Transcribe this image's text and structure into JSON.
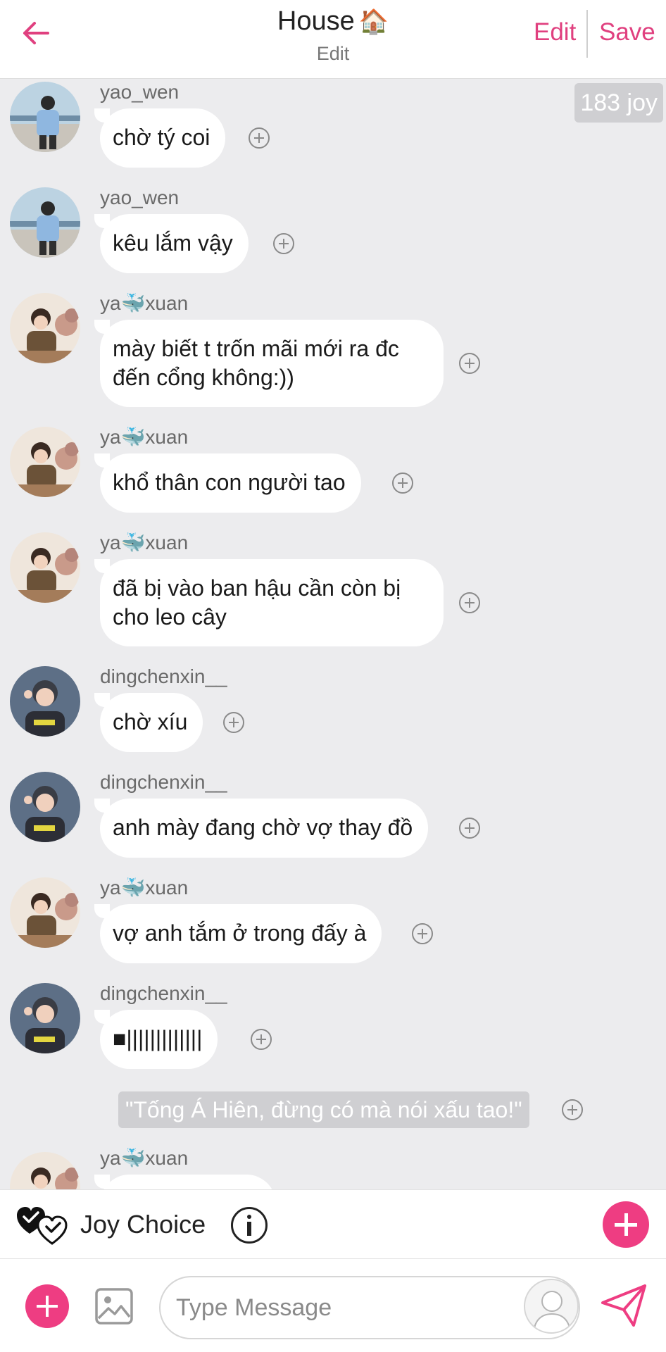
{
  "header": {
    "title": "House",
    "title_emoji": "🏠",
    "subtitle": "Edit",
    "edit_label": "Edit",
    "save_label": "Save",
    "back_icon": "arrow-left-icon",
    "accent_color": "#e0407f"
  },
  "chat": {
    "joy_badge": "183 joy",
    "messages": [
      {
        "user": "yao_wen",
        "lines": [
          "chờ tý coi"
        ],
        "avatar": "yao-wen"
      },
      {
        "user": "yao_wen",
        "lines": [
          "kêu lắm vậy"
        ],
        "avatar": "yao-wen"
      },
      {
        "user": "ya🐳xuan",
        "lines": [
          "mày biết t trốn mãi mới ra đc",
          "đến cổng không:))"
        ],
        "avatar": "yaxuan"
      },
      {
        "user": "ya🐳xuan",
        "lines": [
          "khổ thân con người tao"
        ],
        "avatar": "yaxuan"
      },
      {
        "user": "ya🐳xuan",
        "lines": [
          "đã bị vào ban hậu cần còn bị",
          "cho leo cây"
        ],
        "avatar": "yaxuan"
      },
      {
        "user": "dingchenxin__",
        "lines": [
          "chờ xíu"
        ],
        "avatar": "dingchenxin"
      },
      {
        "user": "dingchenxin__",
        "lines": [
          "anh mày đang chờ vợ thay đồ"
        ],
        "avatar": "dingchenxin"
      },
      {
        "user": "ya🐳xuan",
        "lines": [
          "vợ anh tắm ở trong đấy à"
        ],
        "avatar": "yaxuan"
      },
      {
        "user": "dingchenxin__",
        "lines": [
          "■|||||||||||||"
        ],
        "avatar": "dingchenxin"
      }
    ],
    "narration": "\"Tống Á Hiên, đừng có mà nói xấu tao!\"",
    "partial_user": "ya🐳xuan"
  },
  "joy_choice": {
    "label": "Joy Choice",
    "icon": "double-check-hearts-icon",
    "info_icon": "info-icon",
    "add_icon": "plus-icon"
  },
  "composer": {
    "placeholder": "Type Message",
    "add_icon": "plus-icon",
    "image_icon": "image-icon",
    "persona_icon": "user-avatar-icon",
    "send_icon": "send-icon",
    "accent_color": "#ee3d82"
  }
}
